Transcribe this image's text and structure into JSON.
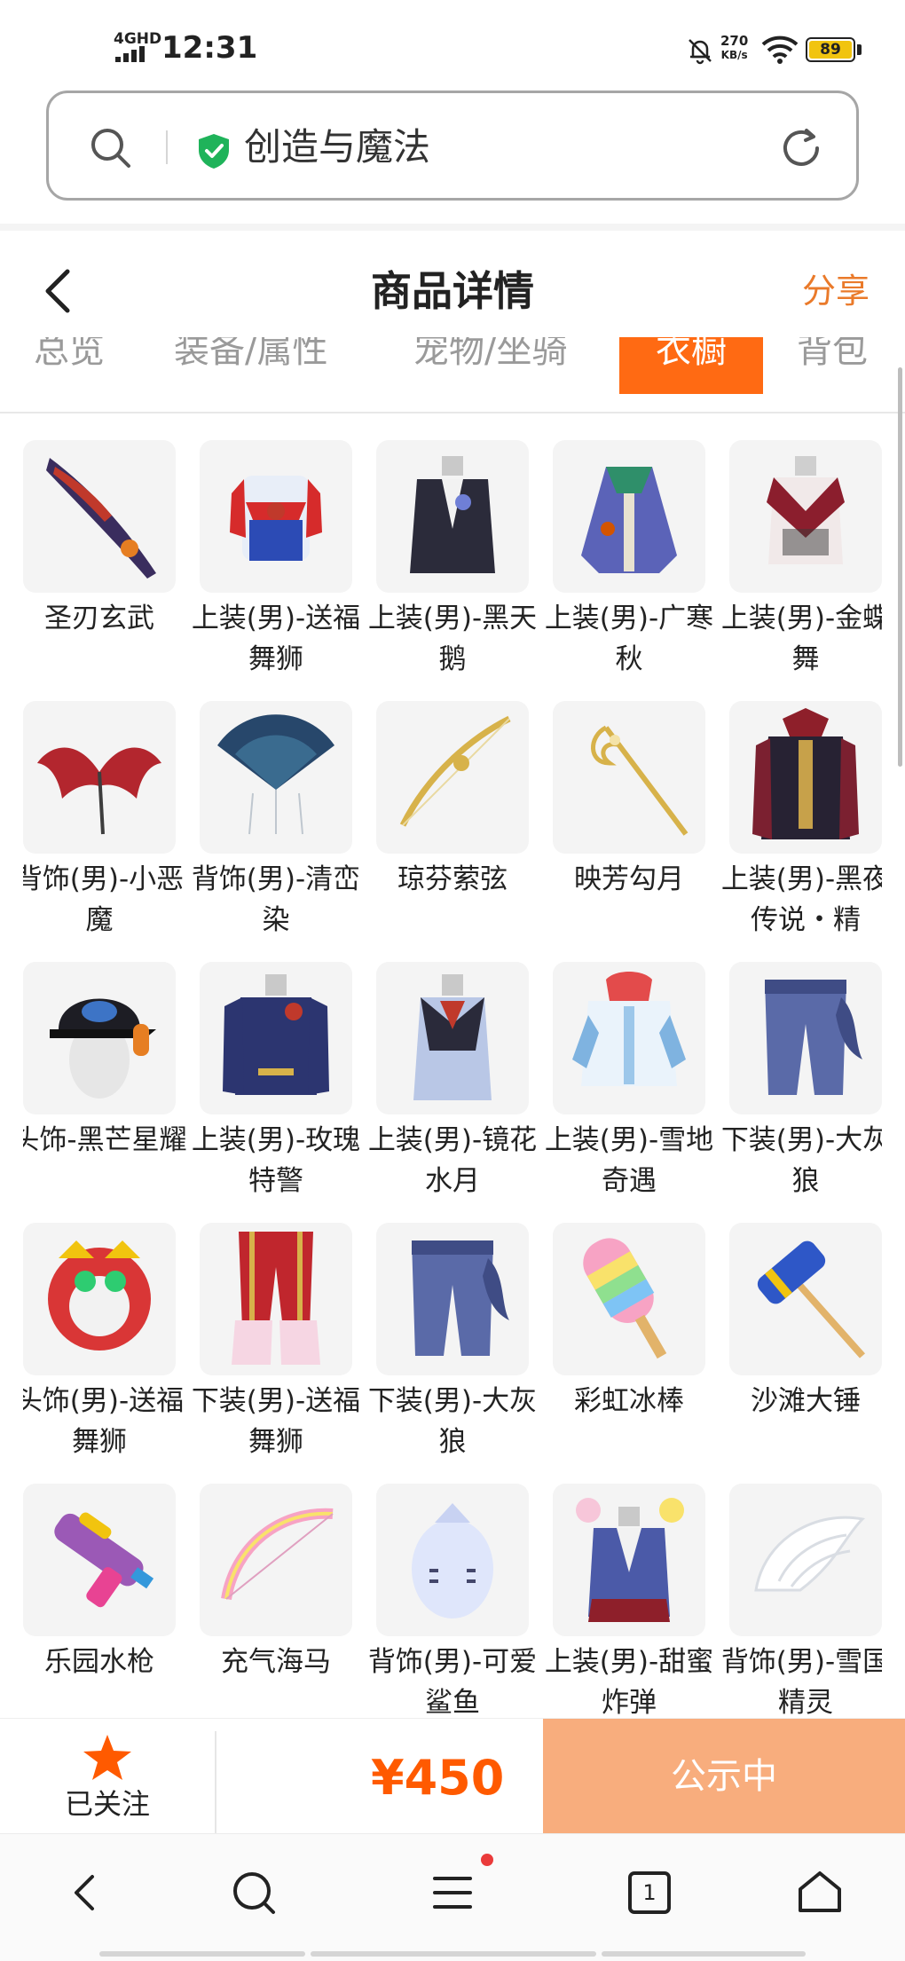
{
  "status_bar": {
    "network": "4GHD",
    "time": "12:31",
    "speed_value": "270",
    "speed_unit": "KB/s",
    "battery": "89"
  },
  "address_bar": {
    "text": "创造与魔法"
  },
  "header": {
    "title": "商品详情",
    "share": "分享"
  },
  "tabs": [
    {
      "label": "总览",
      "active": false
    },
    {
      "label": "装备/属性",
      "active": false
    },
    {
      "label": "宠物/坐骑",
      "active": false
    },
    {
      "label": "衣橱",
      "active": true
    },
    {
      "label": "背包",
      "active": false
    }
  ],
  "items": [
    {
      "name": "圣刃玄武",
      "icon": "blade-icon"
    },
    {
      "name": "上装(男)-送福舞狮",
      "icon": "lion-dance-top-icon"
    },
    {
      "name": "上装(男)-黑天鹅",
      "icon": "black-swan-top-icon"
    },
    {
      "name": "上装(男)-广寒秋",
      "icon": "autumn-robe-icon"
    },
    {
      "name": "上装(男)-金蝶舞",
      "icon": "butterfly-top-icon"
    },
    {
      "name": "背饰(男)-小恶魔",
      "icon": "devil-wings-icon"
    },
    {
      "name": "背饰(男)-清峦染",
      "icon": "fan-back-icon"
    },
    {
      "name": "琼芬萦弦",
      "icon": "golden-bow-icon"
    },
    {
      "name": "映芳勾月",
      "icon": "golden-staff-icon"
    },
    {
      "name": "上装(男)-黑夜传说・精",
      "icon": "night-legend-top-icon"
    },
    {
      "name": "头饰-黑芒星耀",
      "icon": "cap-headphones-icon"
    },
    {
      "name": "上装(男)-玫瑰特警",
      "icon": "rose-uniform-icon"
    },
    {
      "name": "上装(男)-镜花水月",
      "icon": "mirror-flower-top-icon"
    },
    {
      "name": "上装(男)-雪地奇遇",
      "icon": "snow-jacket-icon"
    },
    {
      "name": "下装(男)-大灰狼",
      "icon": "wolf-pants-icon"
    },
    {
      "name": "头饰(男)-送福舞狮",
      "icon": "lion-head-icon"
    },
    {
      "name": "下装(男)-送福舞狮",
      "icon": "lion-pants-icon"
    },
    {
      "name": "下装(男)-大灰狼",
      "icon": "wolf-pants-icon"
    },
    {
      "name": "彩虹冰棒",
      "icon": "rainbow-popsicle-icon"
    },
    {
      "name": "沙滩大锤",
      "icon": "beach-hammer-icon"
    },
    {
      "name": "乐园水枪",
      "icon": "water-gun-icon"
    },
    {
      "name": "充气海马",
      "icon": "inflatable-bow-icon"
    },
    {
      "name": "背饰(男)-可爱鲨鱼",
      "icon": "shark-backpack-icon"
    },
    {
      "name": "上装(男)-甜蜜炸弹",
      "icon": "candy-suit-icon"
    },
    {
      "name": "背饰(男)-雪国精灵",
      "icon": "snow-wings-icon"
    }
  ],
  "bottom_bar": {
    "follow_label": "已关注",
    "price": "¥450",
    "status_button": "公示中"
  },
  "nav_bar": {
    "tab_count": "1"
  },
  "colors": {
    "accent": "#ff6a13",
    "price": "#ff5a00",
    "status_button": "#f8ad7d",
    "share": "#ea7a2a"
  }
}
